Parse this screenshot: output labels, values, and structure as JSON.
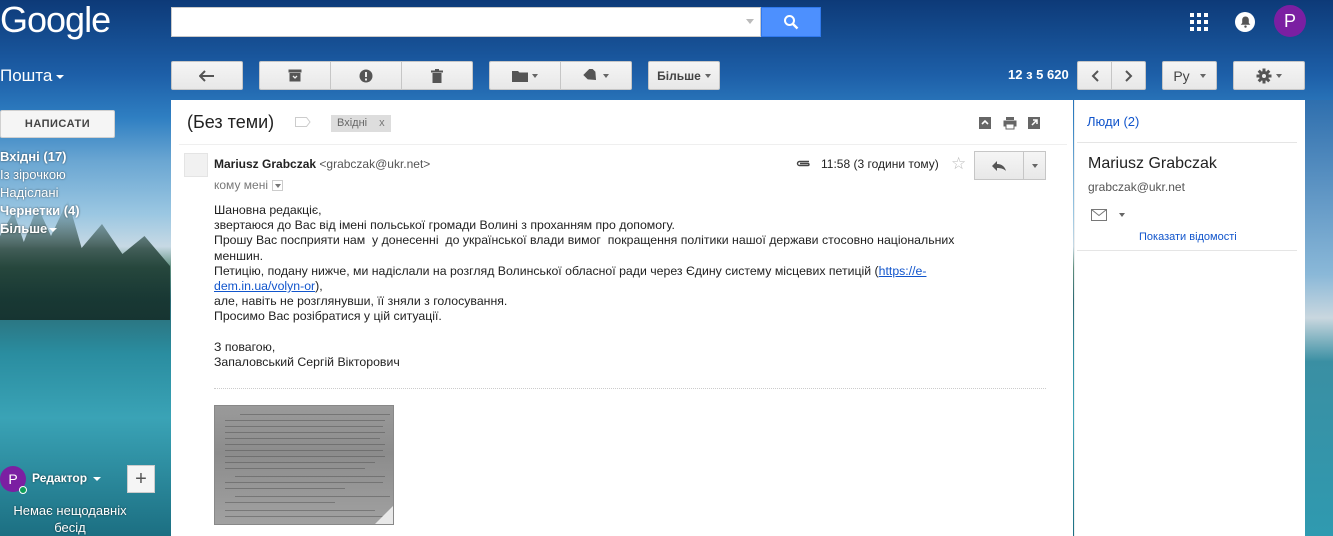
{
  "header": {
    "logo_text": "Google",
    "search_value": "",
    "avatar_letter": "P"
  },
  "toolbar": {
    "app_label": "Пошта",
    "more_label": "Більше",
    "pager_text": "12 з 5 620",
    "lang_label": "Ру"
  },
  "sidebar": {
    "compose_label": "НАПИСАТИ",
    "items": [
      {
        "label": "Вхідні (17)",
        "bold": true
      },
      {
        "label": "Із зірочкою",
        "bold": false
      },
      {
        "label": "Надіслані",
        "bold": false
      },
      {
        "label": "Чернетки (4)",
        "bold": true
      },
      {
        "label": "Більше",
        "bold": false
      }
    ],
    "hangouts": {
      "avatar_letter": "P",
      "user_name": "Редактор",
      "plus": "+",
      "empty_text": "Немає нещодавніх бесід"
    }
  },
  "message": {
    "subject": "(Без теми)",
    "inbox_chip": "Вхідні",
    "chip_close": "x",
    "sender_name": "Mariusz Grabczak",
    "sender_email": "<grabczak@ukr.net>",
    "to_me": "кому мені",
    "time": "11:58 (3 години тому)",
    "body": {
      "line1": "Шановна редакціє,",
      "line2": "звертаюся до Вас від імені польської громади Волині з проханням про допомогу.",
      "line3": "Прошу Вас посприяти нам  у донесенні  до української влади вимог  покращення політики нашої держави стосовно національних",
      "line4": "меншин.",
      "line5_prefix": "Петицію, подану нижче, ми надіслали на розгляд Волинської обласної ради через Єдину систему місцевих петицій (",
      "link_part1": "https://e-",
      "link_part2": "dem.in.ua/volyn-or",
      "line6_suffix": "),",
      "line7": "але, навіть не розглянувши, її зняли з голосування.",
      "line8": "Просимо Вас розібратися у цій ситуації.",
      "line9": "З повагою,",
      "line10": "Запаловський Сергій Вікторович"
    }
  },
  "people": {
    "title": "Люди (2)",
    "person_name": "Mariusz Grabczak",
    "person_email": "grabczak@ukr.net",
    "show_details": "Показати відомості"
  },
  "colors": {
    "accent_blue": "#4d90fe",
    "link": "#1155cc",
    "avatar_purple": "#7b1fa2",
    "online_green": "#0f9d58"
  }
}
